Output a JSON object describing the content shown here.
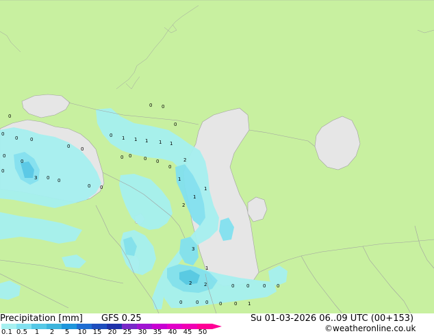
{
  "header": {
    "title": "Precipitation [mm]",
    "model": "GFS 0.25",
    "valid_time": "Su 01-03-2026 06..09 UTC (00+153)",
    "credit": "©weatheronline.co.uk"
  },
  "legend": {
    "ticks": [
      "0.1",
      "0.5",
      "1",
      "2",
      "5",
      "10",
      "15",
      "20",
      "25",
      "30",
      "35",
      "40",
      "45",
      "50"
    ],
    "colors": [
      "#a6f0f0",
      "#82e1f0",
      "#55c8e6",
      "#3cb4dc",
      "#1e96dc",
      "#1e6ed2",
      "#1e4ebe",
      "#1e32aa",
      "#7828c8",
      "#a014d2",
      "#c800d2",
      "#e100c8",
      "#f000b4",
      "#ff0096"
    ]
  },
  "colors": {
    "land": "#c8f0a0",
    "sea": "#e6e6e6",
    "border": "#a0a0a0",
    "precip_light": "#a6f0f0",
    "precip_medium": "#82e1f0",
    "precip_heavy": "#55c8e6"
  },
  "markers": [
    "0",
    "0",
    "0",
    "0",
    "0",
    "0",
    "0",
    "0",
    "0",
    "1",
    "1",
    "1",
    "1",
    "1",
    "1",
    "1",
    "2",
    "2",
    "2",
    "3",
    "3",
    "0",
    "0",
    "0",
    "0",
    "0",
    "1",
    "0",
    "0",
    "0",
    "0",
    "0",
    "2",
    "0",
    "0",
    "0",
    "0",
    "0",
    "1",
    "0",
    "1",
    "0",
    "0",
    "0",
    "0",
    "0",
    "0"
  ]
}
